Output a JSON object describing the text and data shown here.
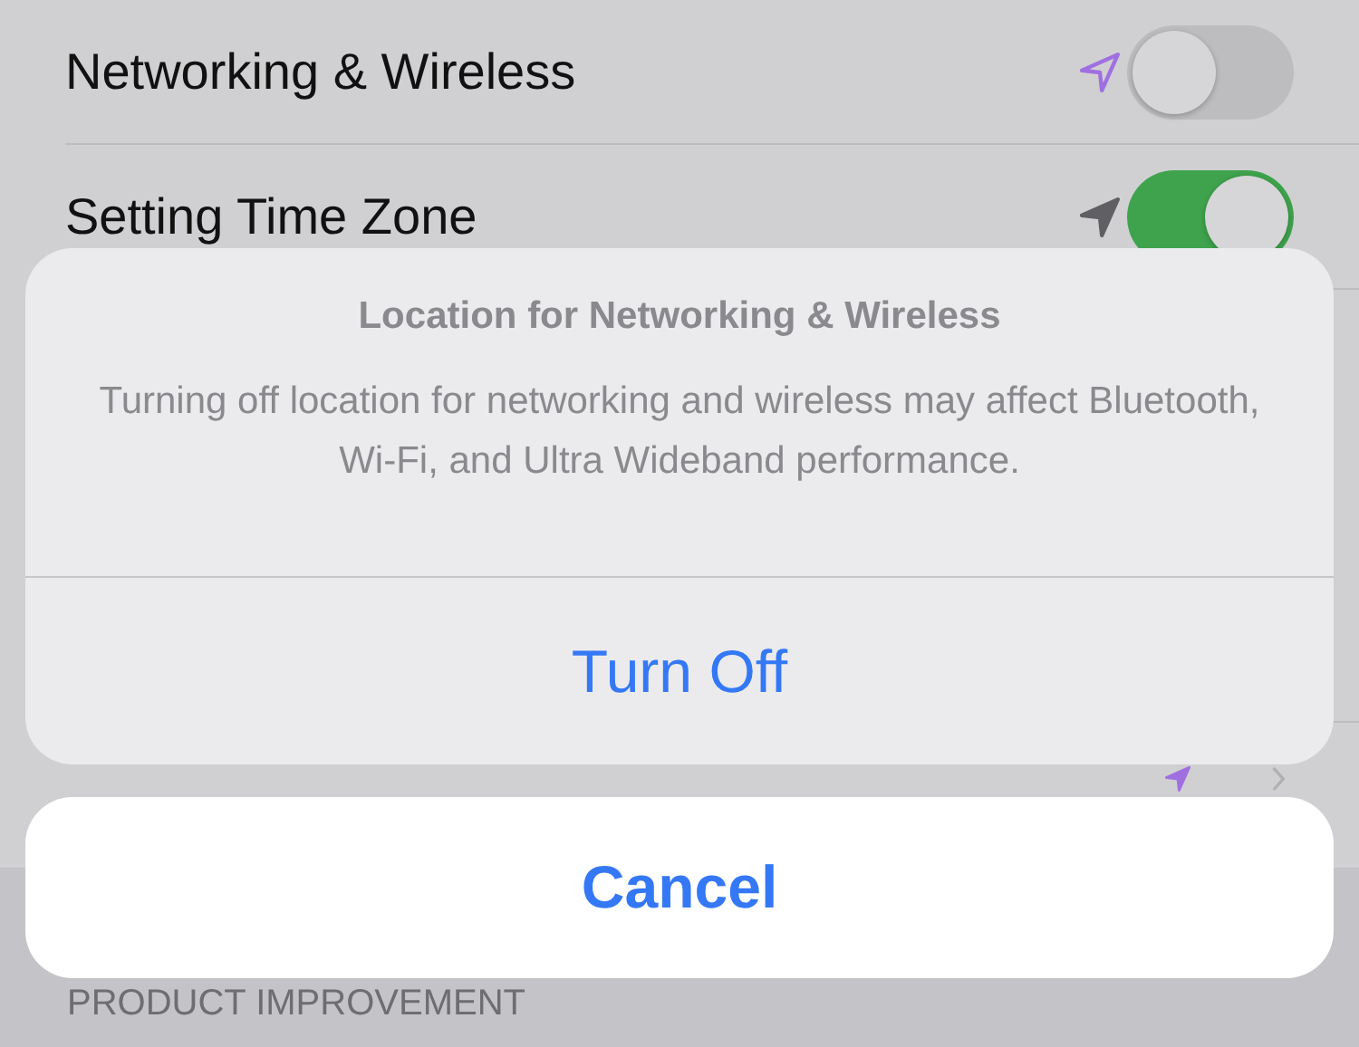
{
  "rows": [
    {
      "label": "Networking & Wireless",
      "kind": "toggle",
      "on": false,
      "arrow_filled": false,
      "color": "#a070e0"
    },
    {
      "label": "Setting Time Zone",
      "kind": "toggle",
      "on": true,
      "arrow_filled": true,
      "color": "#606064"
    },
    {
      "kind": "detail",
      "arrow_filled": true,
      "color": "#a070e0"
    }
  ],
  "section_header": "PRODUCT IMPROVEMENT",
  "alert": {
    "title": "Location for Networking & Wireless",
    "message": "Turning off location for networking and wireless may affect Bluetooth, Wi-Fi, and Ultra Wideband performance.",
    "actions": [
      {
        "label": "Turn Off"
      }
    ],
    "cancel": "Cancel"
  }
}
